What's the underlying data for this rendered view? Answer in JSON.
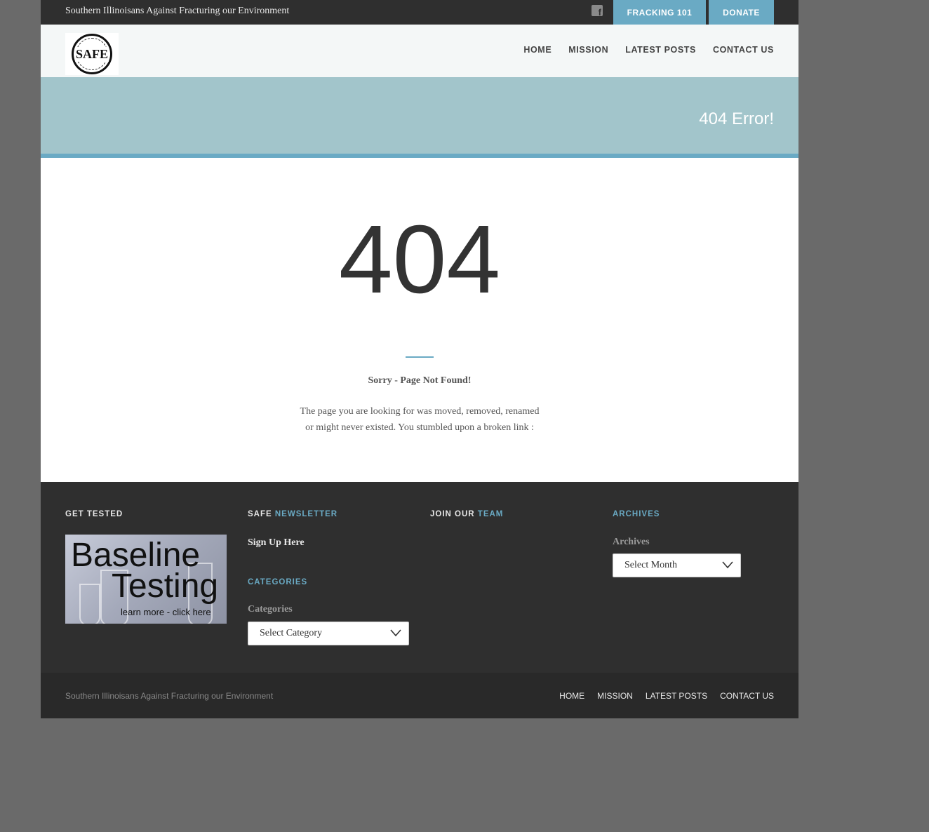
{
  "topbar": {
    "tagline": "Southern Illinoisans Against Fracturing our Environment",
    "social_icon": "facebook-icon",
    "fracking_label": "FRACKING 101",
    "donate_label": "DONATE"
  },
  "header": {
    "logo_text": "SAFE",
    "nav": [
      "HOME",
      "MISSION",
      "LATEST POSTS",
      "CONTACT US"
    ]
  },
  "banner": {
    "title": "404 Error!"
  },
  "content": {
    "code": "404",
    "heading": "Sorry - Page Not Found!",
    "message_line1": "The page you are looking for was moved, removed, renamed",
    "message_line2": "or might never existed. You stumbled upon a broken link :"
  },
  "footer": {
    "get_tested": {
      "heading": "GET TESTED",
      "image_line1": "Baseline",
      "image_line2": "Testing",
      "image_line3": "learn more - click here"
    },
    "newsletter": {
      "heading_a": "SAFE ",
      "heading_b": "NEWSLETTER",
      "link": "Sign Up Here"
    },
    "categories": {
      "heading": "CATEGORIES",
      "label": "Categories",
      "select": "Select Category"
    },
    "team": {
      "heading_a": "JOIN OUR ",
      "heading_b": "TEAM"
    },
    "archives": {
      "heading": "ARCHIVES",
      "label": "Archives",
      "select": "Select Month"
    }
  },
  "bottom": {
    "copy": "Southern Illinoisans Against Fracturing our Environment",
    "nav": [
      "HOME",
      "MISSION",
      "LATEST POSTS",
      "CONTACT US"
    ]
  },
  "colors": {
    "accent": "#6aaac4",
    "dark": "#2f2f2f",
    "banner": "#a2c5cb"
  }
}
